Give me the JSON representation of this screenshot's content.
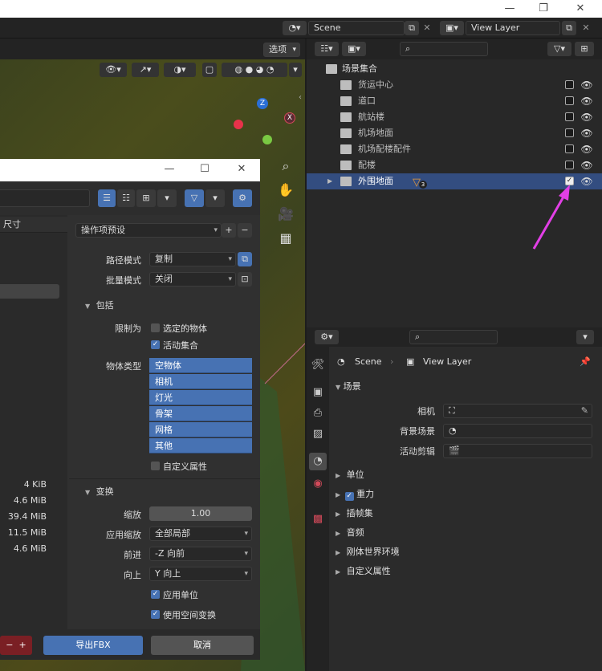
{
  "topbar": {
    "scene_label": "Scene",
    "view_layer_label": "View Layer"
  },
  "viewport": {
    "options_label": "选项"
  },
  "outliner": {
    "root": "场景集合",
    "items": [
      {
        "label": "货运中心"
      },
      {
        "label": "道口"
      },
      {
        "label": "航站楼"
      },
      {
        "label": "机场地面"
      },
      {
        "label": "机场配楼配件"
      },
      {
        "label": "配楼"
      },
      {
        "label": "外围地面",
        "badge": "3",
        "checked": true
      }
    ]
  },
  "properties": {
    "breadcrumb_scene": "Scene",
    "breadcrumb_view_layer": "View Layer",
    "scene_section": "场景",
    "camera_label": "相机",
    "background_scene_label": "背景场景",
    "active_clip_label": "活动剪辑",
    "sections": [
      {
        "label": "单位"
      },
      {
        "label": "重力",
        "checkbox": true
      },
      {
        "label": "插帧集"
      },
      {
        "label": "音频"
      },
      {
        "label": "刚体世界环境"
      },
      {
        "label": "自定义属性"
      }
    ]
  },
  "export_dialog": {
    "column_header": "尺寸",
    "file_sizes": [
      "4 KiB",
      "4.6 MiB",
      "39.4 MiB",
      "11.5 MiB",
      "4.6 MiB"
    ],
    "operator_presets": "操作项预设",
    "path_mode_label": "路径模式",
    "path_mode_value": "复制",
    "batch_mode_label": "批量模式",
    "batch_mode_value": "关闭",
    "include_section": "包括",
    "limit_to_label": "限制为",
    "selected_objects": "选定的物体",
    "active_collection": "活动集合",
    "object_types_label": "物体类型",
    "object_types": [
      "空物体",
      "相机",
      "灯光",
      "骨架",
      "网格",
      "其他"
    ],
    "custom_properties": "自定义属性",
    "transform_section": "变换",
    "scale_label": "缩放",
    "scale_value": "1.00",
    "apply_scale_label": "应用缩放",
    "apply_scale_value": "全部局部",
    "forward_label": "前进",
    "forward_value": "-Z 向前",
    "up_label": "向上",
    "up_value": "Y 向上",
    "apply_unit": "应用单位",
    "use_space_transform": "使用空间变换",
    "export_button": "导出FBX",
    "cancel_button": "取消"
  },
  "gizmo": {
    "z": "Z",
    "x": "X"
  },
  "colors": {
    "accent": "#4772b3",
    "arrow": "#e23fe6"
  }
}
